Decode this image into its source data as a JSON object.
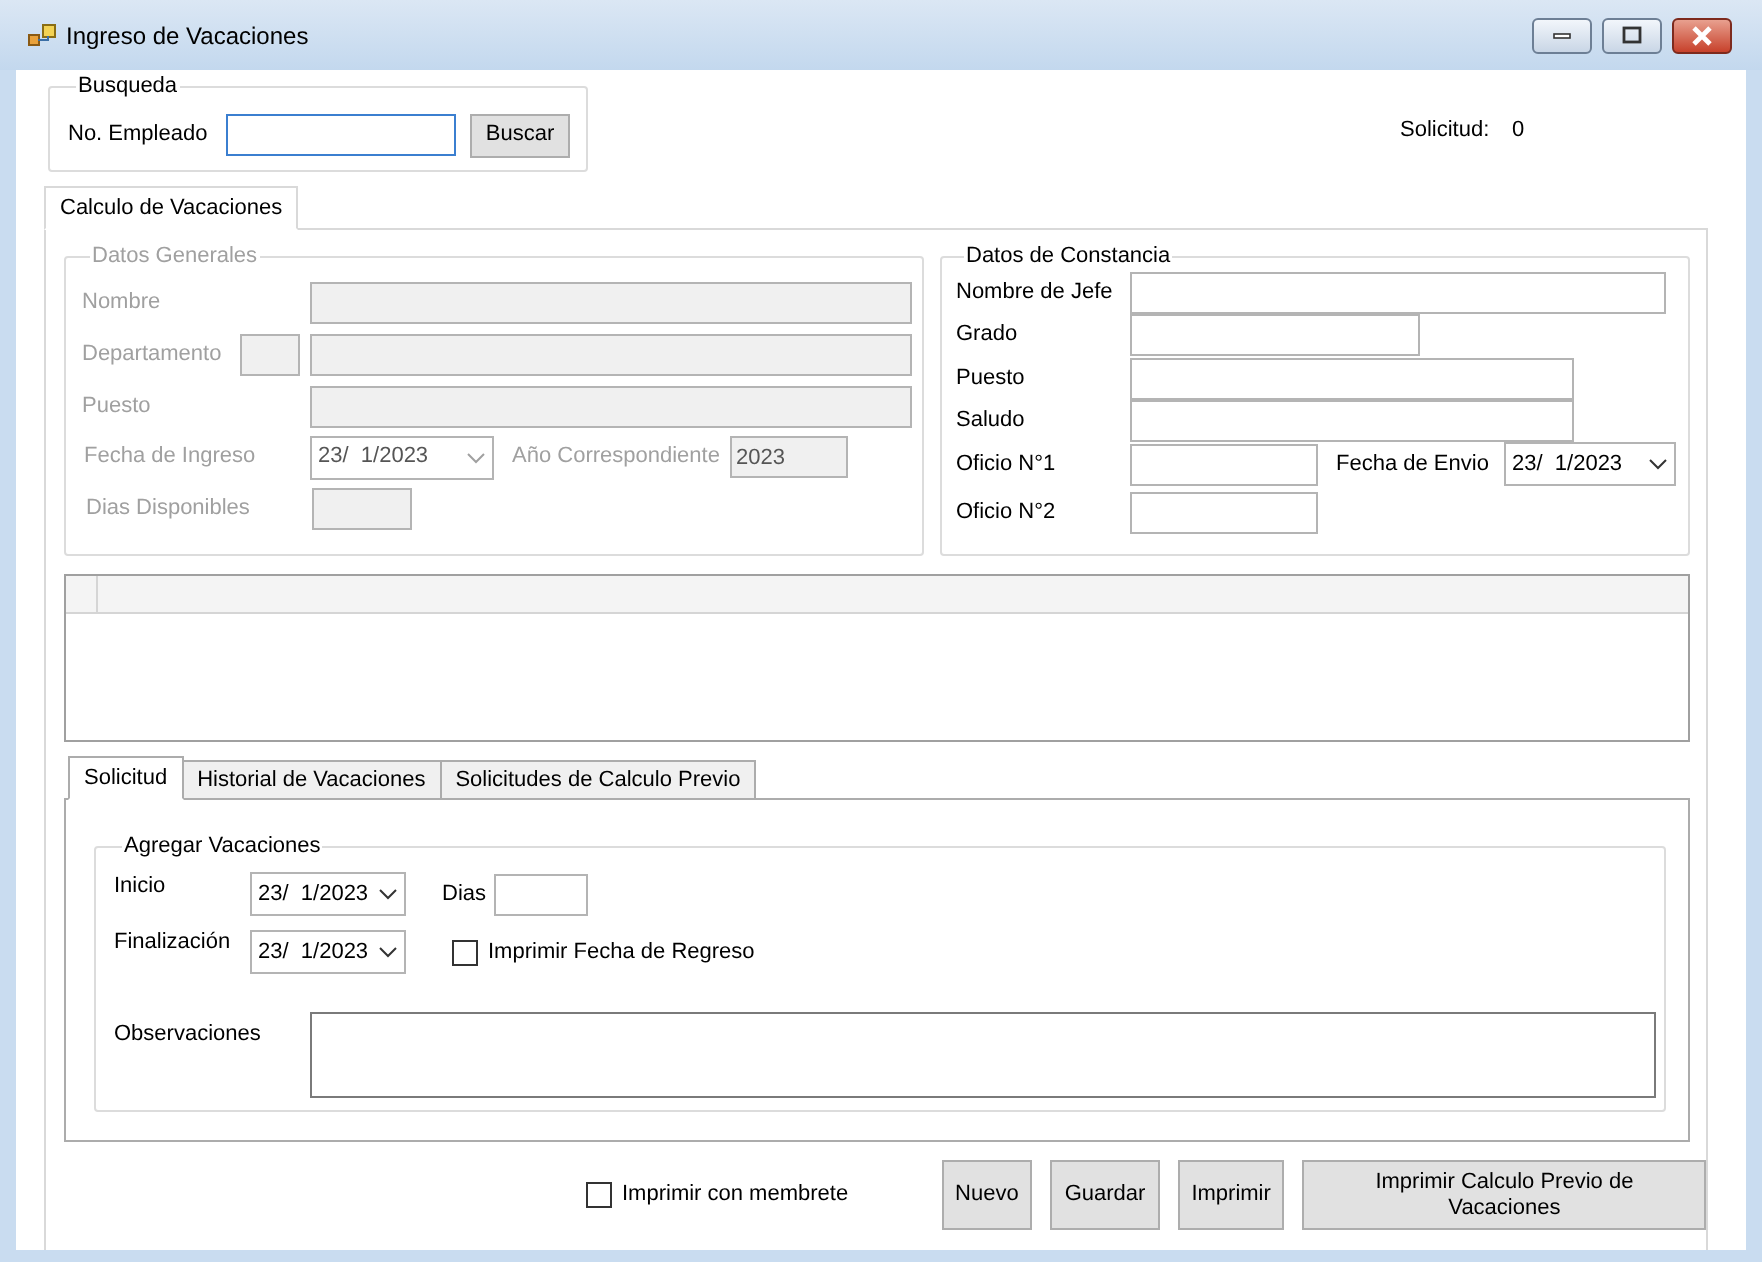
{
  "window": {
    "title": "Ingreso de Vacaciones"
  },
  "search": {
    "title": "Busqueda",
    "label": "No. Empleado",
    "focused": true,
    "button": "Buscar"
  },
  "request_number": {
    "label": "Solicitud:",
    "value": "0"
  },
  "main_tabs": [
    {
      "label": "Calculo de Vacaciones",
      "selected": true
    }
  ],
  "general": {
    "title": "Datos Generales",
    "disabled": true,
    "name": {
      "label": "Nombre"
    },
    "department": {
      "label": "Departamento"
    },
    "position": {
      "label": "Puesto"
    },
    "hire_date": {
      "label": "Fecha de Ingreso",
      "value": "23/  1/2023"
    },
    "year": {
      "label": "Año Correspondiente",
      "value": "2023"
    },
    "available_days": {
      "label": "Dias Disponibles"
    }
  },
  "certificate": {
    "title": "Datos de Constancia",
    "boss_name": {
      "label": "Nombre de Jefe"
    },
    "grade": {
      "label": "Grado"
    },
    "position": {
      "label": "Puesto"
    },
    "greeting": {
      "label": "Saludo"
    },
    "office_1": {
      "label": "Oficio N°1"
    },
    "send_date": {
      "label": "Fecha de Envio",
      "value": "23/  1/2023"
    },
    "office_2": {
      "label": "Oficio N°2"
    }
  },
  "sub_tabs": [
    {
      "label": "Solicitud",
      "selected": true
    },
    {
      "label": "Historial de Vacaciones",
      "selected": false
    },
    {
      "label": "Solicitudes de Calculo Previo",
      "selected": false
    }
  ],
  "add_vacation": {
    "title": "Agregar Vacaciones",
    "start": {
      "label": "Inicio",
      "value": "23/  1/2023"
    },
    "days": {
      "label": "Dias"
    },
    "end": {
      "label": "Finalización",
      "value": "23/  1/2023"
    },
    "print_return": {
      "label": "Imprimir Fecha de Regreso",
      "checked": false
    },
    "notes": {
      "label": "Observaciones"
    }
  },
  "letterhead": {
    "label": "Imprimir con membrete",
    "checked": false
  },
  "buttons": [
    "Nuevo",
    "Guardar",
    "Imprimir",
    "Imprimir Calculo Previo de Vacaciones"
  ]
}
